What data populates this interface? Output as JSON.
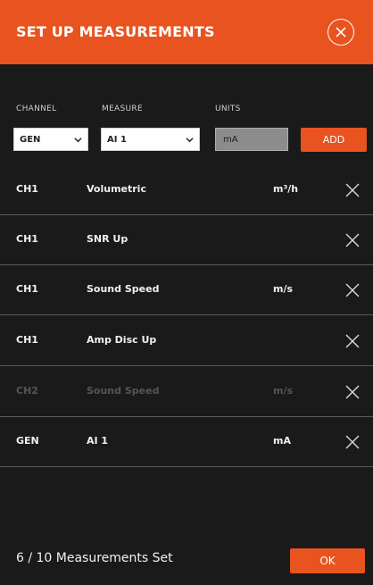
{
  "header": {
    "title": "SET UP MEASUREMENTS",
    "close_icon": "close-circle-icon"
  },
  "form": {
    "channel_label": "CHANNEL",
    "measure_label": "MEASURE",
    "units_label": "UNITS",
    "channel_value": "GEN",
    "measure_value": "AI 1",
    "units_value": "mA",
    "add_label": "ADD"
  },
  "rows": [
    {
      "channel": "CH1",
      "measure": "Volumetric",
      "unit": "m³/h"
    },
    {
      "channel": "CH1",
      "measure": "SNR Up",
      "unit": ""
    },
    {
      "channel": "CH1",
      "measure": "Sound Speed",
      "unit": "m/s"
    },
    {
      "channel": "CH1",
      "measure": "Amp Disc Up",
      "unit": ""
    },
    {
      "channel": "CH2",
      "measure": "Sound Speed",
      "unit": "m/s"
    },
    {
      "channel": "GEN",
      "measure": "AI 1",
      "unit": "mA"
    }
  ],
  "footer": {
    "count_text": "6 / 10 Measurements Set",
    "ok_label": "OK"
  },
  "colors": {
    "accent": "#e8531f",
    "background": "#1a1a1a",
    "dimmed_text": "#555555"
  }
}
